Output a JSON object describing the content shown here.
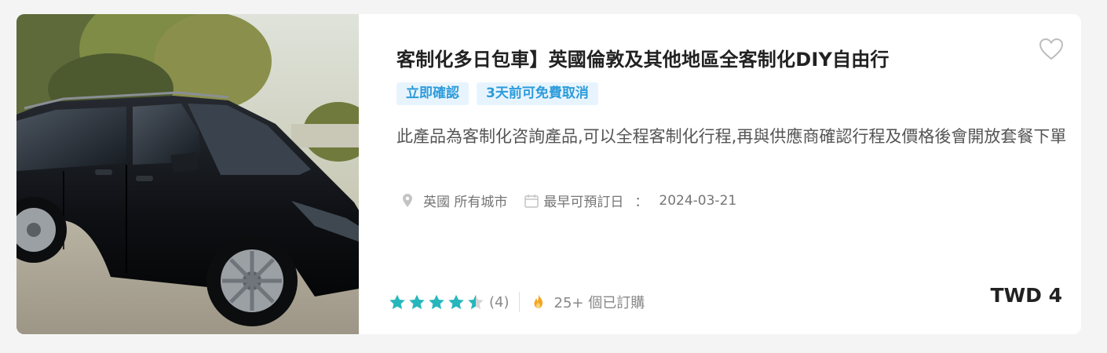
{
  "product": {
    "title": "客制化多日包車】英國倫敦及其他地區全客制化DIY自由行",
    "tags": [
      "立即確認",
      "3天前可免費取消"
    ],
    "description": "此產品為客制化咨詢產品,可以全程客制化行程,再與供應商確認行程及價格後會開放套餐下單",
    "location": "英國 所有城市",
    "earliest_date_label": "最早可預訂日",
    "colon": "：",
    "earliest_date": "2024-03-21",
    "rating_count": "(4)",
    "booked": "25+ 個已訂購",
    "price": "TWD 4",
    "rating": 4.5
  },
  "icons": {
    "favorite": "heart-outline-icon",
    "location": "map-pin-icon",
    "calendar": "calendar-icon",
    "star": "star-icon",
    "popular": "fire-icon"
  },
  "colors": {
    "tag_bg": "#e8f4fd",
    "tag_text": "#2d9cdb",
    "star": "#26b7bc",
    "fire": "#f5a623"
  }
}
